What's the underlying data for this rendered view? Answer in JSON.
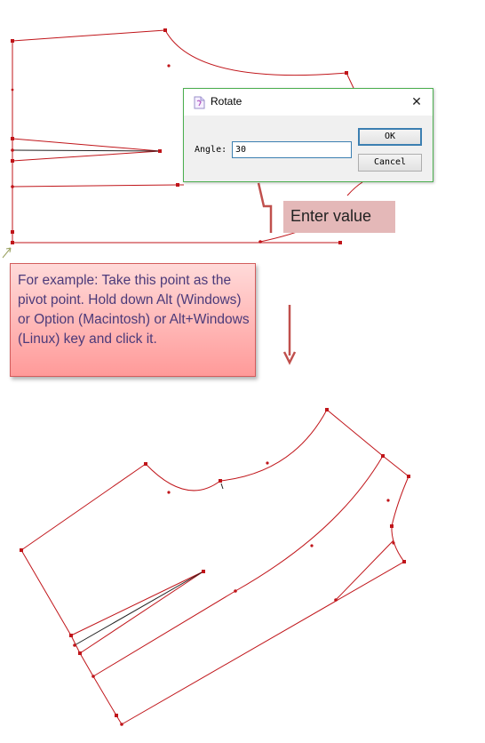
{
  "dialog": {
    "title": "Rotate",
    "close_glyph": "✕",
    "angle_label": "Angle:",
    "angle_value": "30",
    "ok_label": "OK",
    "cancel_label": "Cancel"
  },
  "callouts": {
    "enter_value": "Enter value",
    "example": "For example: Take this point as the pivot point. Hold down Alt (Windows) or Option (Macintosh) or Alt+Windows (Linux) key and click it."
  },
  "colors": {
    "pattern_line": "#c0151a",
    "dialog_border": "#4caf50",
    "arrow": "#c0504d"
  },
  "icons": {
    "dialog": "document-icon",
    "close": "close-icon",
    "down_arrow": "down-arrow-icon",
    "pivot_cursor": "cursor-arrow-icon"
  }
}
